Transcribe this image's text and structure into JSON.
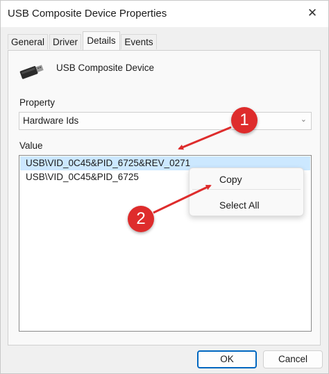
{
  "window": {
    "title": "USB Composite Device Properties",
    "close_glyph": "✕"
  },
  "tabs": [
    {
      "label": "General",
      "active": false
    },
    {
      "label": "Driver",
      "active": false
    },
    {
      "label": "Details",
      "active": true
    },
    {
      "label": "Events",
      "active": false
    }
  ],
  "device": {
    "name": "USB Composite Device",
    "icon": "usb-device-icon"
  },
  "property": {
    "label": "Property",
    "selected_value": "Hardware Ids",
    "chevron": "⌄"
  },
  "value": {
    "label": "Value",
    "items": [
      {
        "text": "USB\\VID_0C45&PID_6725&REV_0271",
        "selected": true
      },
      {
        "text": "USB\\VID_0C45&PID_6725",
        "selected": false
      }
    ]
  },
  "context_menu": {
    "items": [
      "Copy",
      "Select All"
    ]
  },
  "annotations": {
    "badge_1": "1",
    "badge_2": "2",
    "color": "#de2c2c"
  },
  "buttons": {
    "ok": "OK",
    "cancel": "Cancel"
  },
  "colors": {
    "selection": "#cce8ff",
    "accent": "#0067c0"
  }
}
